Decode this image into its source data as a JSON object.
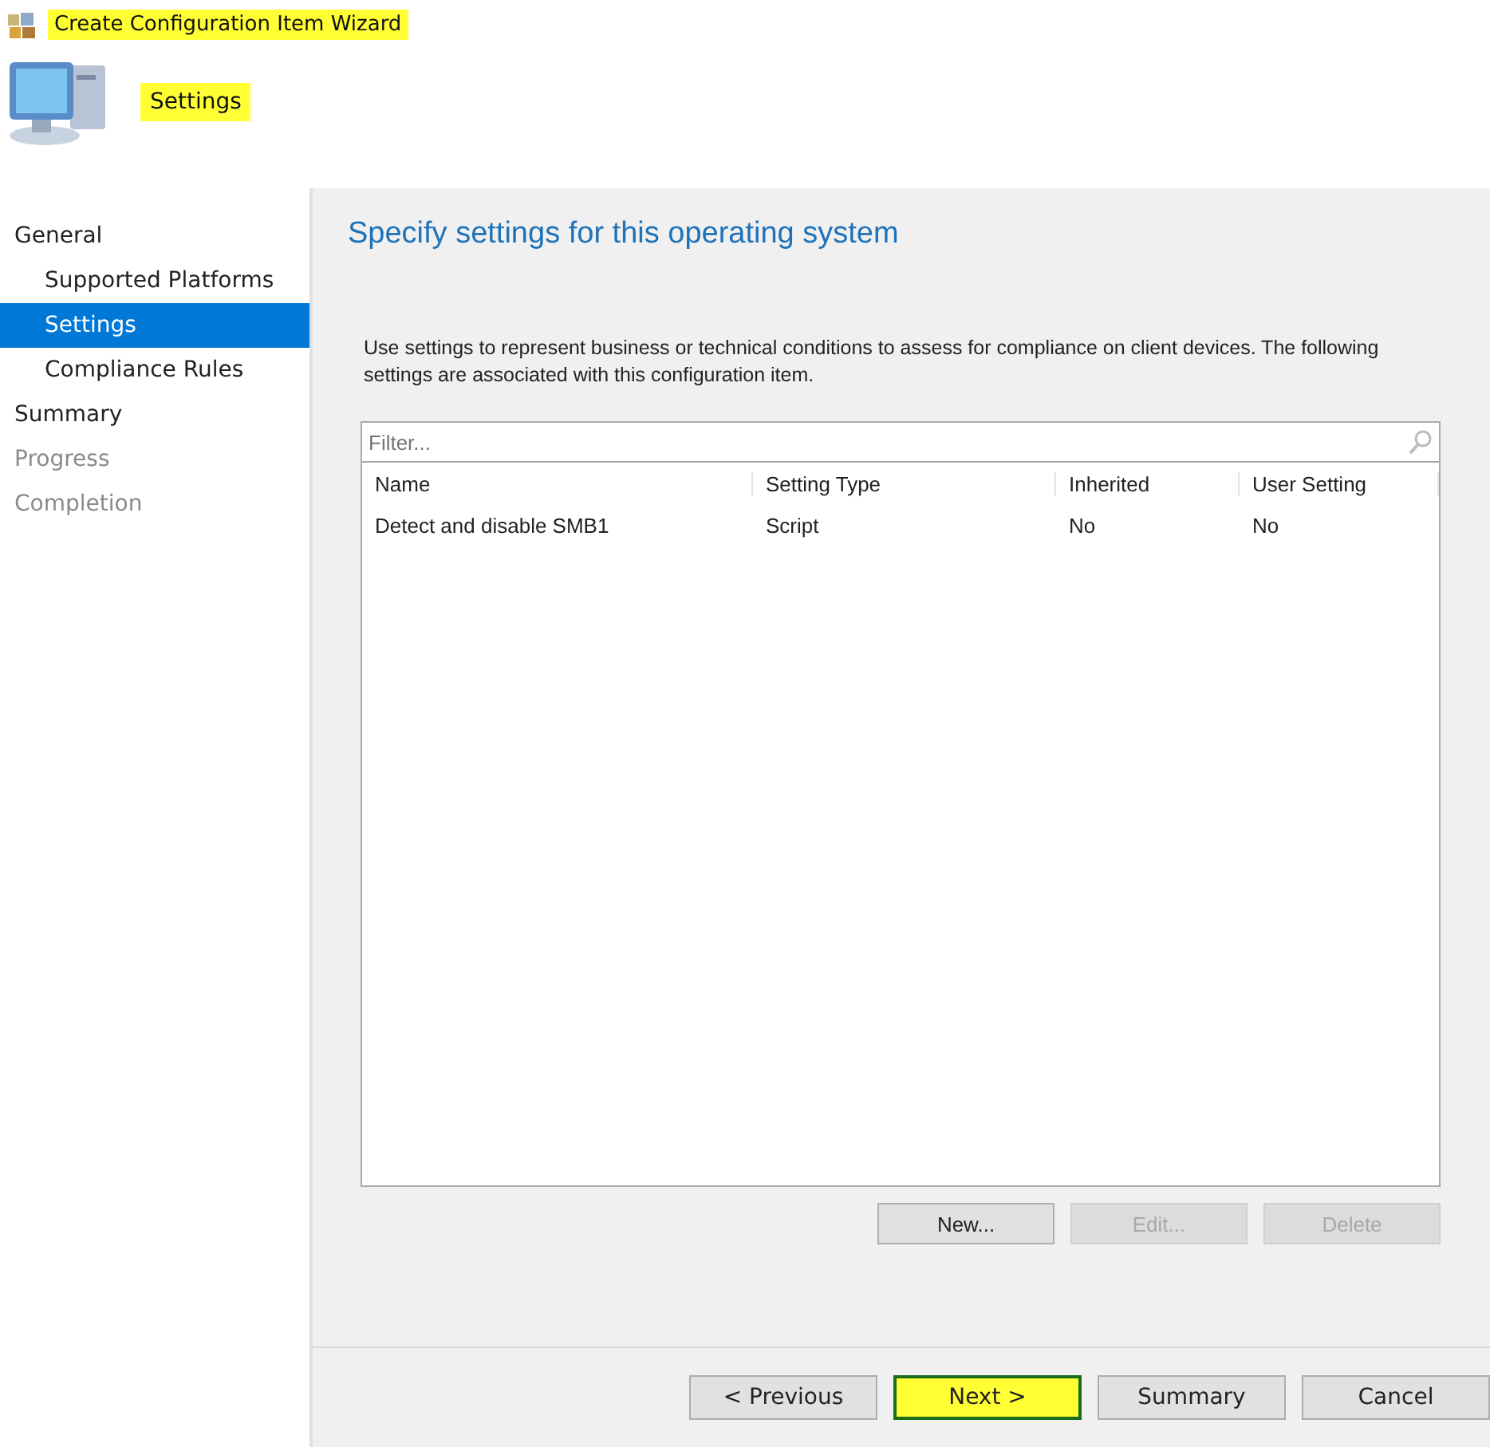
{
  "window": {
    "title": "Create Configuration Item Wizard",
    "title_highlighted": true
  },
  "header": {
    "heading": "Settings",
    "highlighted": true
  },
  "sidebar": {
    "items": [
      {
        "label": "General",
        "selected": false,
        "disabled": false,
        "children": [
          {
            "label": "Supported Platforms",
            "selected": false,
            "disabled": false
          },
          {
            "label": "Settings",
            "selected": true,
            "disabled": false
          },
          {
            "label": "Compliance Rules",
            "selected": false,
            "disabled": false
          }
        ]
      },
      {
        "label": "Summary",
        "selected": false,
        "disabled": false
      },
      {
        "label": "Progress",
        "selected": false,
        "disabled": true
      },
      {
        "label": "Completion",
        "selected": false,
        "disabled": true
      }
    ]
  },
  "page": {
    "title": "Specify settings for this operating system",
    "description": "Use settings to represent business or technical conditions to assess for compliance on client devices. The following settings are associated with this configuration item."
  },
  "filter": {
    "placeholder": "Filter..."
  },
  "table": {
    "columns": [
      "Name",
      "Setting Type",
      "Inherited",
      "User Setting"
    ],
    "rows": [
      [
        "Detect and disable SMB1",
        "Script",
        "No",
        "No"
      ]
    ]
  },
  "actions": [
    {
      "label": "New...",
      "disabled": false
    },
    {
      "label": "Edit...",
      "disabled": true
    },
    {
      "label": "Delete",
      "disabled": true
    }
  ],
  "nav_buttons": [
    {
      "label": "< Previous",
      "highlighted": false
    },
    {
      "label": "Next >",
      "highlighted": true
    },
    {
      "label": "Summary",
      "highlighted": false
    },
    {
      "label": "Cancel",
      "highlighted": false
    }
  ]
}
